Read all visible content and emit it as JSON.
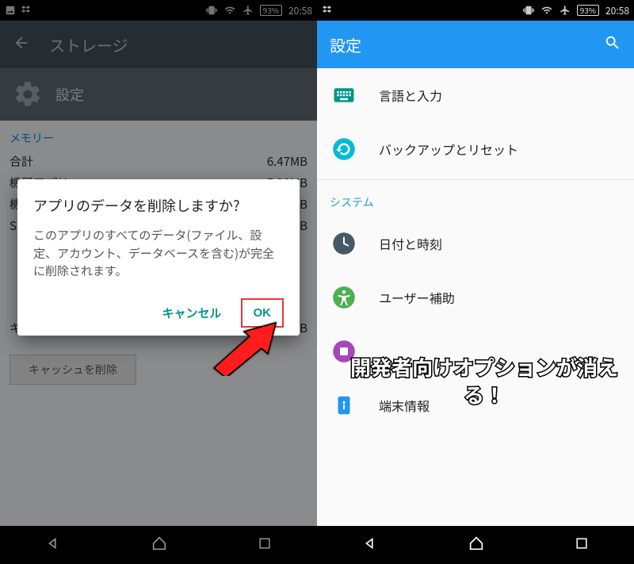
{
  "status": {
    "battery": "93%",
    "time": "20:58"
  },
  "left": {
    "toolbar_title": "ストレージ",
    "app_name": "設定",
    "section_memory": "メモリー",
    "rows": [
      {
        "label": "合計",
        "value": "6.47MB"
      },
      {
        "label": "機器アプリ",
        "value": "5.98MB"
      },
      {
        "label": "機",
        "value": "B"
      },
      {
        "label": "S",
        "value": "B"
      }
    ],
    "cache_row_label": "キ",
    "cache_row_value": "B",
    "clear_cache_btn": "キャッシュを削除",
    "dialog": {
      "title": "アプリのデータを削除しますか?",
      "body": "このアプリのすべてのデータ(ファイル、設定、アカウント、データベースを含む)が完全に削除されます。",
      "cancel": "キャンセル",
      "ok": "OK"
    }
  },
  "right": {
    "toolbar_title": "設定",
    "section_system": "システム",
    "items": {
      "lang": "言語と入力",
      "backup": "バックアップとリセット",
      "datetime": "日付と時刻",
      "accessibility": "ユーザー補助",
      "about": "端末情報"
    }
  },
  "annotation": "開発者向けオプションが消える！"
}
